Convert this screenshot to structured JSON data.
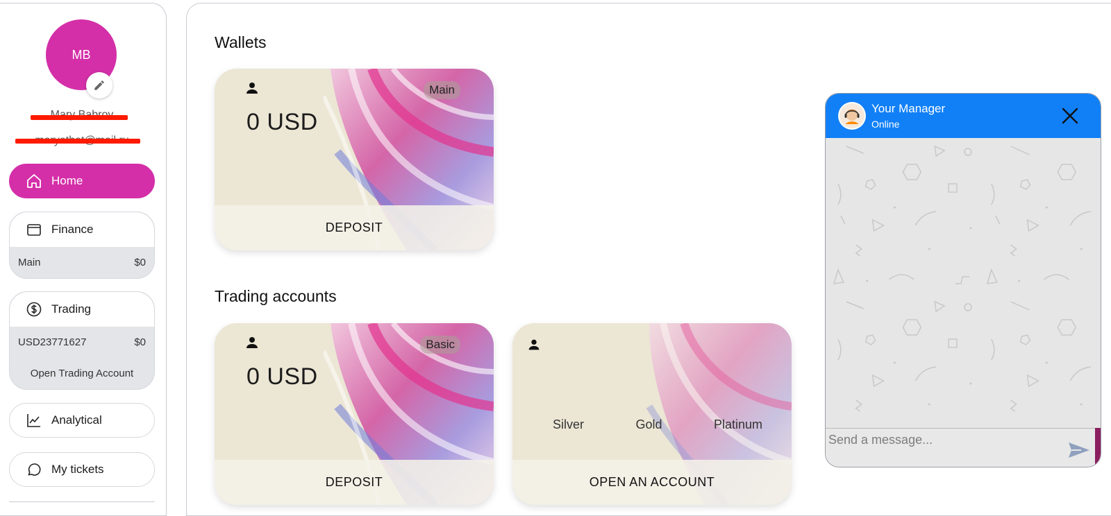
{
  "profile": {
    "initials": "MB",
    "name": "Mary Babrov",
    "email": "maryetbat@mail.ru"
  },
  "nav": {
    "home": "Home",
    "finance": {
      "label": "Finance",
      "rows": [
        {
          "name": "Main",
          "value": "$0"
        }
      ]
    },
    "trading": {
      "label": "Trading",
      "rows": [
        {
          "name": "USD23771627",
          "value": "$0"
        }
      ],
      "open_account": "Open Trading Account"
    },
    "analytical": "Analytical",
    "tickets": "My tickets"
  },
  "wallets": {
    "title": "Wallets",
    "cards": [
      {
        "badge": "Main",
        "amount": "0 USD",
        "action": "DEPOSIT"
      }
    ]
  },
  "trading_accounts": {
    "title": "Trading accounts",
    "cards": [
      {
        "badge": "Basic",
        "amount": "0 USD",
        "action": "DEPOSIT"
      }
    ],
    "open_card": {
      "tiers": [
        "Silver",
        "Gold",
        "Platinum"
      ],
      "action": "OPEN AN ACCOUNT"
    }
  },
  "chat": {
    "title": "Your Manager",
    "status": "Online",
    "placeholder": "Send a message...",
    "header_color": "#1180f7"
  },
  "colors": {
    "accent": "#d42fa8",
    "card_bg": "#ece6d5"
  }
}
